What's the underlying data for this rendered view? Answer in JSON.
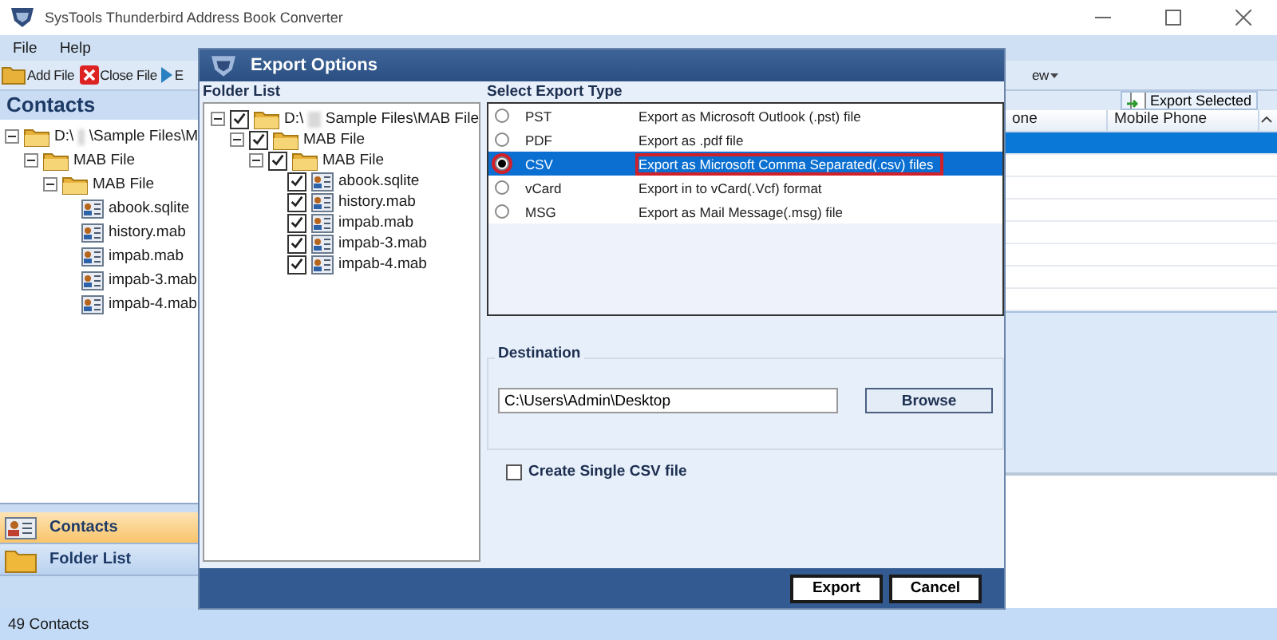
{
  "window": {
    "title": "SysTools Thunderbird Address Book Converter"
  },
  "menu": [
    "File",
    "Help"
  ],
  "toolbar": [
    {
      "label": "Add File",
      "kind": "add"
    },
    {
      "label": "Close File",
      "kind": "close"
    },
    {
      "label": "E",
      "kind": "export"
    }
  ],
  "toolbar_right": {
    "view": "ew",
    "export_selected": "Export Selected"
  },
  "contacts_panel": {
    "title": "Contacts",
    "tree": [
      {
        "label": "D:\\",
        "label_after": "\\Sample Files\\M",
        "kind": "drive",
        "children": [
          {
            "label": "MAB File",
            "kind": "folder",
            "children": [
              {
                "label": "MAB File",
                "kind": "folder",
                "children": [
                  {
                    "label": "abook.sqlite",
                    "kind": "file"
                  },
                  {
                    "label": "history.mab",
                    "kind": "file"
                  },
                  {
                    "label": "impab.mab",
                    "kind": "file"
                  },
                  {
                    "label": "impab-3.mab",
                    "kind": "file"
                  },
                  {
                    "label": "impab-4.mab",
                    "kind": "file"
                  }
                ]
              }
            ]
          }
        ]
      }
    ]
  },
  "nav": [
    {
      "label": "Contacts",
      "selected": true,
      "kind": "contacts"
    },
    {
      "label": "Folder List",
      "selected": false,
      "kind": "folder"
    }
  ],
  "table": {
    "columns": [
      "one",
      "Mobile Phone"
    ],
    "rows": [
      {
        "selected": true
      },
      {
        "selected": false
      },
      {
        "selected": false
      },
      {
        "selected": false
      },
      {
        "selected": false
      },
      {
        "selected": false
      },
      {
        "selected": false
      },
      {
        "selected": false
      }
    ]
  },
  "status_bar": "49 Contacts",
  "dialog": {
    "title": "Export Options",
    "folder_list": {
      "title": "Folder List",
      "tree": [
        {
          "label": "D:\\",
          "label_after": "Sample Files\\MAB File",
          "kind": "drive",
          "checked": true,
          "children": [
            {
              "label": "MAB File",
              "kind": "folder",
              "checked": true,
              "children": [
                {
                  "label": "MAB File",
                  "kind": "folder",
                  "checked": true,
                  "children": [
                    {
                      "label": "abook.sqlite",
                      "kind": "file",
                      "checked": true
                    },
                    {
                      "label": "history.mab",
                      "kind": "file",
                      "checked": true
                    },
                    {
                      "label": "impab.mab",
                      "kind": "file",
                      "checked": true
                    },
                    {
                      "label": "impab-3.mab",
                      "kind": "file",
                      "checked": true
                    },
                    {
                      "label": "impab-4.mab",
                      "kind": "file",
                      "checked": true
                    }
                  ]
                }
              ]
            }
          ]
        }
      ]
    },
    "export_type": {
      "title": "Select Export Type",
      "options": [
        {
          "name": "PST",
          "description": "Export as Microsoft Outlook (.pst) file",
          "selected": false,
          "highlighted": false
        },
        {
          "name": "PDF",
          "description": "Export as .pdf file",
          "selected": false,
          "highlighted": false
        },
        {
          "name": "CSV",
          "description": "Export as Microsoft Comma Separated(.csv) files",
          "selected": true,
          "highlighted": true
        },
        {
          "name": "vCard",
          "description": "Export in to vCard(.Vcf) format",
          "selected": false,
          "highlighted": false
        },
        {
          "name": "MSG",
          "description": "Export as Mail Message(.msg) file",
          "selected": false,
          "highlighted": false
        }
      ]
    },
    "destination": {
      "title": "Destination",
      "value": "C:\\Users\\Admin\\Desktop",
      "browse": "Browse"
    },
    "single_csv": {
      "label": "Create Single CSV file",
      "checked": false
    },
    "buttons": [
      "Export",
      "Cancel"
    ]
  }
}
